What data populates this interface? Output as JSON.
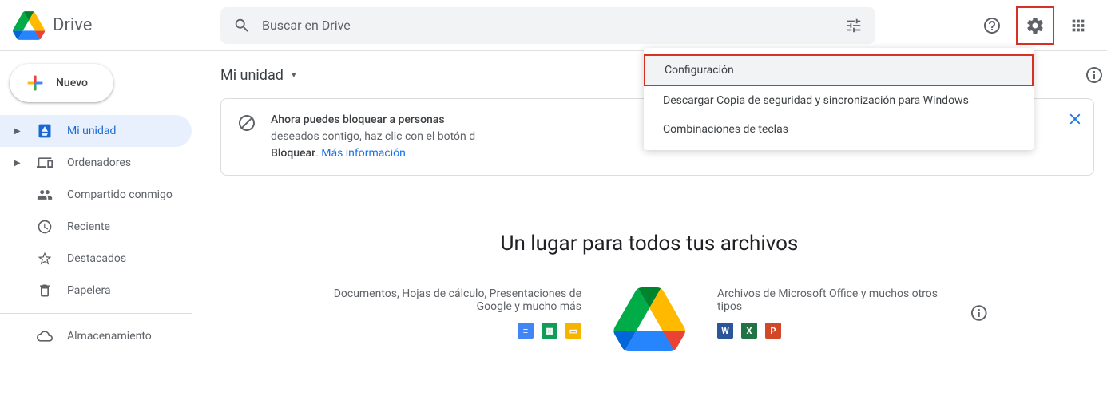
{
  "app_name": "Drive",
  "search": {
    "placeholder": "Buscar en Drive"
  },
  "new_button": "Nuevo",
  "sidebar": {
    "items": [
      {
        "label": "Mi unidad",
        "icon": "drive-folder",
        "caret": true,
        "active": true
      },
      {
        "label": "Ordenadores",
        "icon": "computers",
        "caret": true
      },
      {
        "label": "Compartido conmigo",
        "icon": "shared"
      },
      {
        "label": "Reciente",
        "icon": "clock"
      },
      {
        "label": "Destacados",
        "icon": "star"
      },
      {
        "label": "Papelera",
        "icon": "trash"
      }
    ],
    "storage": "Almacenamiento"
  },
  "breadcrumb": {
    "label": "Mi unidad"
  },
  "banner": {
    "line1_bold": "Ahora puedes bloquear a personas ",
    "line2": "deseados contigo, haz clic con el botón d",
    "line3_bold": "Bloquear",
    "line3_sep": ". ",
    "link": "Más información"
  },
  "empty": {
    "title": "Un lugar para todos tus archivos",
    "left_text": "Documentos, Hojas de cálculo, Presentaciones de Google y mucho más",
    "right_text": "Archivos de Microsoft Office y muchos otros tipos",
    "google_icons": [
      "docs",
      "sheets",
      "slides"
    ],
    "ms_icons": [
      "word",
      "excel",
      "powerpoint"
    ]
  },
  "menu": {
    "items": [
      "Configuración",
      "Descargar Copia de seguridad y sincronización para Windows",
      "Combinaciones de teclas"
    ]
  }
}
